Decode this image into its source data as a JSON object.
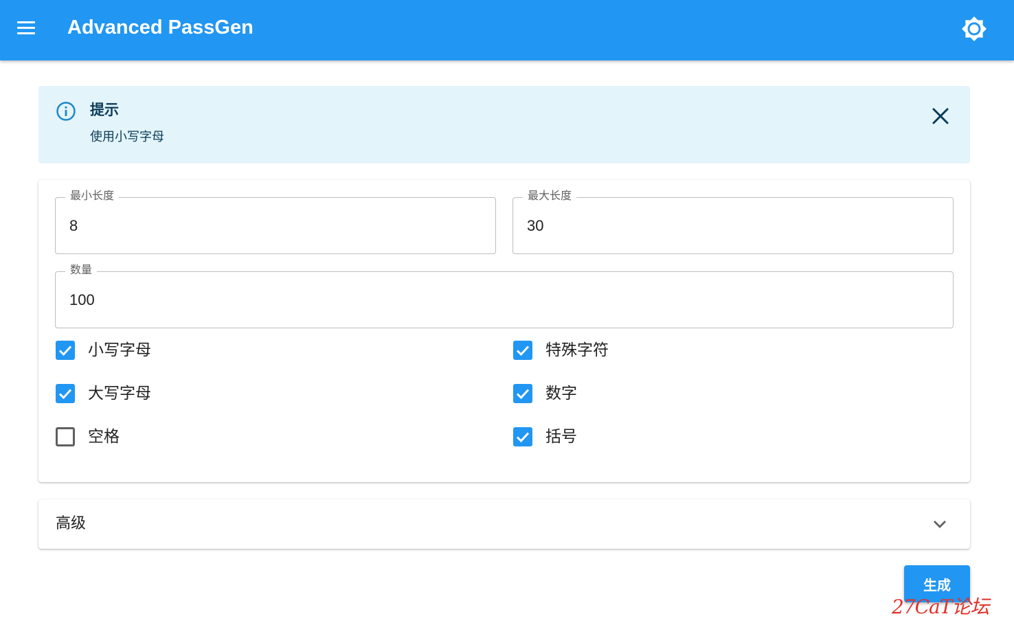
{
  "appbar": {
    "title": "Advanced PassGen",
    "menu_icon": "hamburger-menu-icon",
    "theme_icon": "brightness-icon",
    "color": "#2196f3"
  },
  "alert": {
    "icon": "info-icon",
    "title": "提示",
    "message": "使用小写字母",
    "close_icon": "close-icon",
    "background": "#e3f4fb"
  },
  "form": {
    "min_length": {
      "label": "最小长度",
      "value": "8"
    },
    "max_length": {
      "label": "最大长度",
      "value": "30"
    },
    "count": {
      "label": "数量",
      "value": "100"
    },
    "options": [
      {
        "label": "小写字母",
        "checked": true
      },
      {
        "label": "特殊字符",
        "checked": true
      },
      {
        "label": "大写字母",
        "checked": true
      },
      {
        "label": "数字",
        "checked": true
      },
      {
        "label": "空格",
        "checked": false
      },
      {
        "label": "括号",
        "checked": true
      }
    ]
  },
  "advanced": {
    "label": "高级",
    "chevron_icon": "chevron-down-icon"
  },
  "generate_button": {
    "label": "生成"
  },
  "watermark": {
    "text": "27CaT论坛",
    "color": "#e0312b"
  }
}
